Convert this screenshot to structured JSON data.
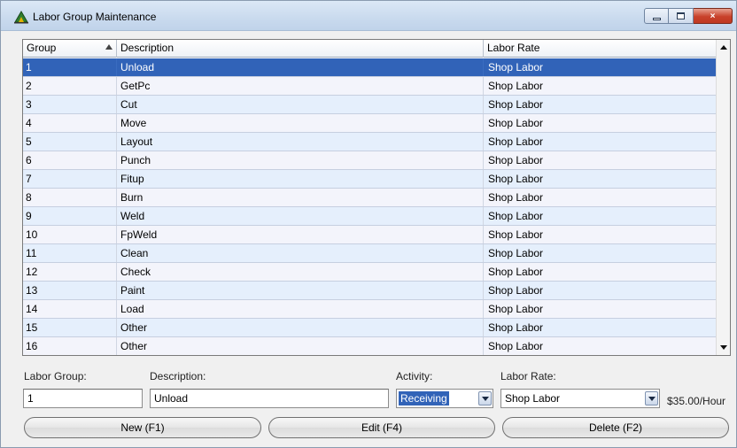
{
  "window": {
    "title": "Labor Group Maintenance",
    "icon": "tree-triangle-icon",
    "controls": {
      "minimize": "minimize-icon",
      "maximize": "maximize-icon",
      "close": "×"
    }
  },
  "grid": {
    "columns": [
      "Group",
      "Description",
      "Labor Rate"
    ],
    "sort_column": "Group",
    "sort_direction": "ascending",
    "selected_row_index": 0,
    "rows": [
      {
        "group": "1",
        "description": "Unload",
        "rate": "Shop Labor"
      },
      {
        "group": "2",
        "description": "GetPc",
        "rate": "Shop Labor"
      },
      {
        "group": "3",
        "description": "Cut",
        "rate": "Shop Labor"
      },
      {
        "group": "4",
        "description": "Move",
        "rate": "Shop Labor"
      },
      {
        "group": "5",
        "description": "Layout",
        "rate": "Shop Labor"
      },
      {
        "group": "6",
        "description": "Punch",
        "rate": "Shop Labor"
      },
      {
        "group": "7",
        "description": "Fitup",
        "rate": "Shop Labor"
      },
      {
        "group": "8",
        "description": "Burn",
        "rate": "Shop Labor"
      },
      {
        "group": "9",
        "description": "Weld",
        "rate": "Shop Labor"
      },
      {
        "group": "10",
        "description": "FpWeld",
        "rate": "Shop Labor"
      },
      {
        "group": "11",
        "description": "Clean",
        "rate": "Shop Labor"
      },
      {
        "group": "12",
        "description": "Check",
        "rate": "Shop Labor"
      },
      {
        "group": "13",
        "description": "Paint",
        "rate": "Shop Labor"
      },
      {
        "group": "14",
        "description": "Load",
        "rate": "Shop Labor"
      },
      {
        "group": "15",
        "description": "Other",
        "rate": "Shop Labor"
      },
      {
        "group": "16",
        "description": "Other",
        "rate": "Shop Labor"
      }
    ]
  },
  "form": {
    "labor_group_label": "Labor Group:",
    "labor_group_value": "1",
    "description_label": "Description:",
    "description_value": "Unload",
    "activity_label": "Activity:",
    "activity_value": "Receiving",
    "labor_rate_label": "Labor Rate:",
    "labor_rate_value": "Shop Labor",
    "rate_amount": "$35.00/Hour"
  },
  "buttons": {
    "new": "New (F1)",
    "edit": "Edit (F4)",
    "delete": "Delete (F2)"
  },
  "colors": {
    "selection": "#3163b8",
    "row_odd": "#e5effc",
    "row_even": "#f3f4fb",
    "titlebar": "#c9daee",
    "close_button": "#c8412a"
  }
}
